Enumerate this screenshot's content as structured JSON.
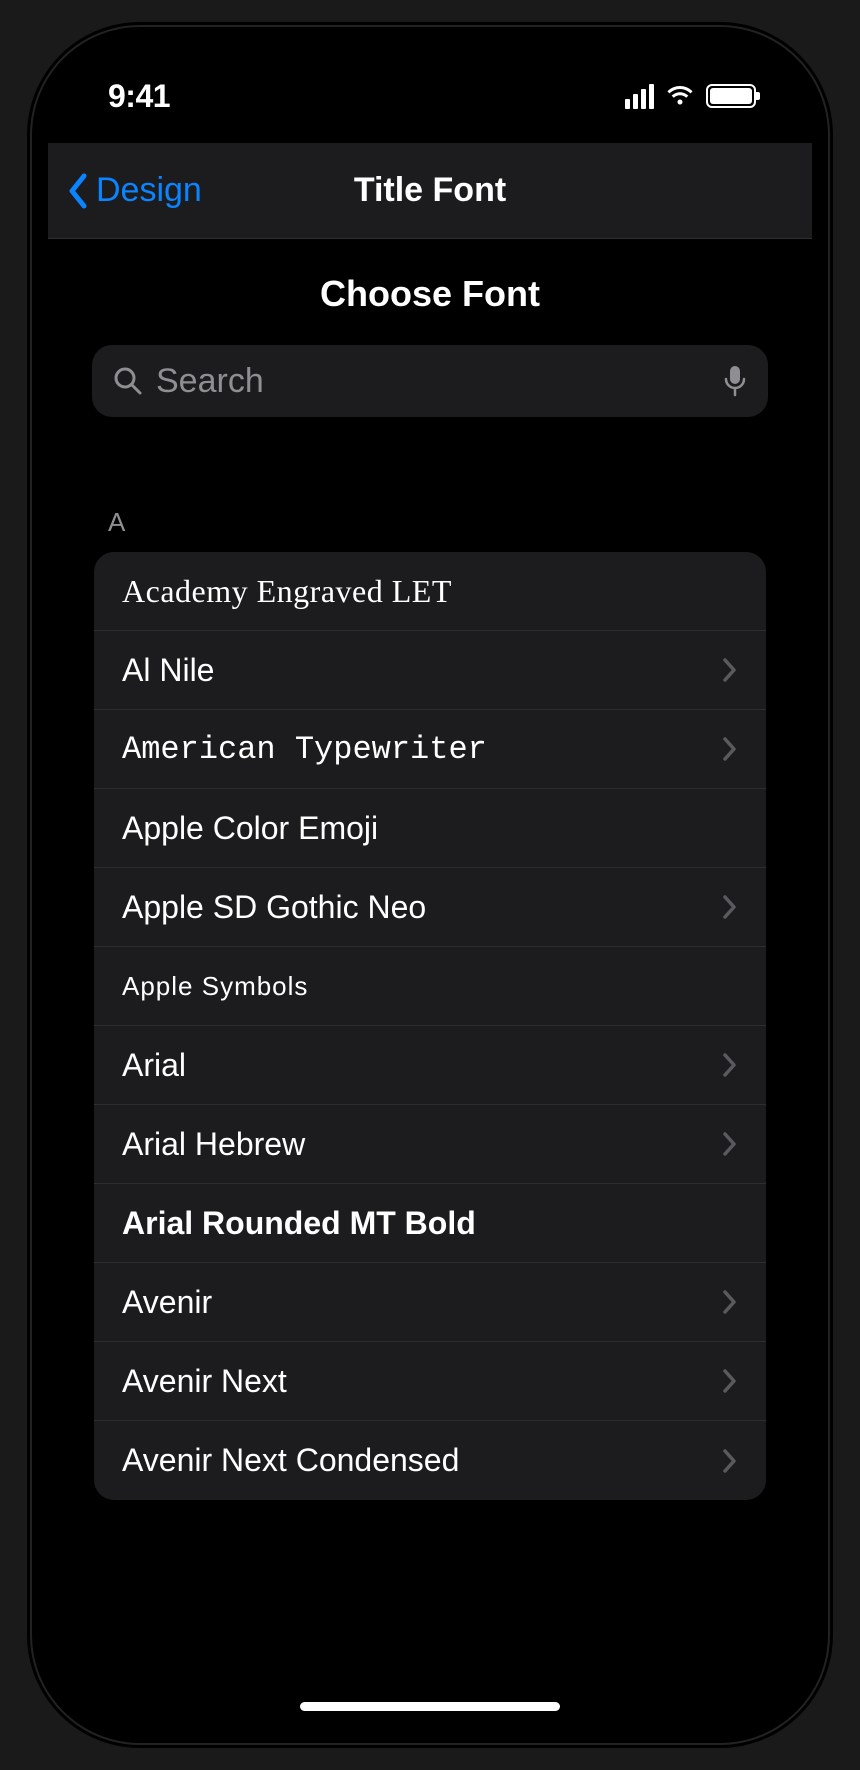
{
  "status": {
    "time": "9:41"
  },
  "nav": {
    "back_label": "Design",
    "title": "Title Font"
  },
  "header": {
    "choose_label": "Choose Font"
  },
  "search": {
    "placeholder": "Search"
  },
  "section": {
    "letter": "A"
  },
  "fonts": [
    {
      "name": "Academy Engraved LET",
      "has_more": false,
      "class": "f-academy"
    },
    {
      "name": "Al Nile",
      "has_more": true,
      "class": "f-alnile"
    },
    {
      "name": "American Typewriter",
      "has_more": true,
      "class": "f-typewriter"
    },
    {
      "name": "Apple Color Emoji",
      "has_more": false,
      "class": "f-sfsans"
    },
    {
      "name": "Apple SD Gothic Neo",
      "has_more": true,
      "class": "f-sfsans"
    },
    {
      "name": "Apple  Symbols",
      "has_more": false,
      "class": "f-symbols"
    },
    {
      "name": "Arial",
      "has_more": true,
      "class": "f-arial"
    },
    {
      "name": "Arial Hebrew",
      "has_more": true,
      "class": "f-arial"
    },
    {
      "name": "Arial Rounded MT Bold",
      "has_more": false,
      "class": "f-arialrounded"
    },
    {
      "name": "Avenir",
      "has_more": true,
      "class": "f-avenir"
    },
    {
      "name": "Avenir Next",
      "has_more": true,
      "class": "f-avenirnext"
    },
    {
      "name": "Avenir Next Condensed",
      "has_more": true,
      "class": "f-avenircond"
    }
  ]
}
